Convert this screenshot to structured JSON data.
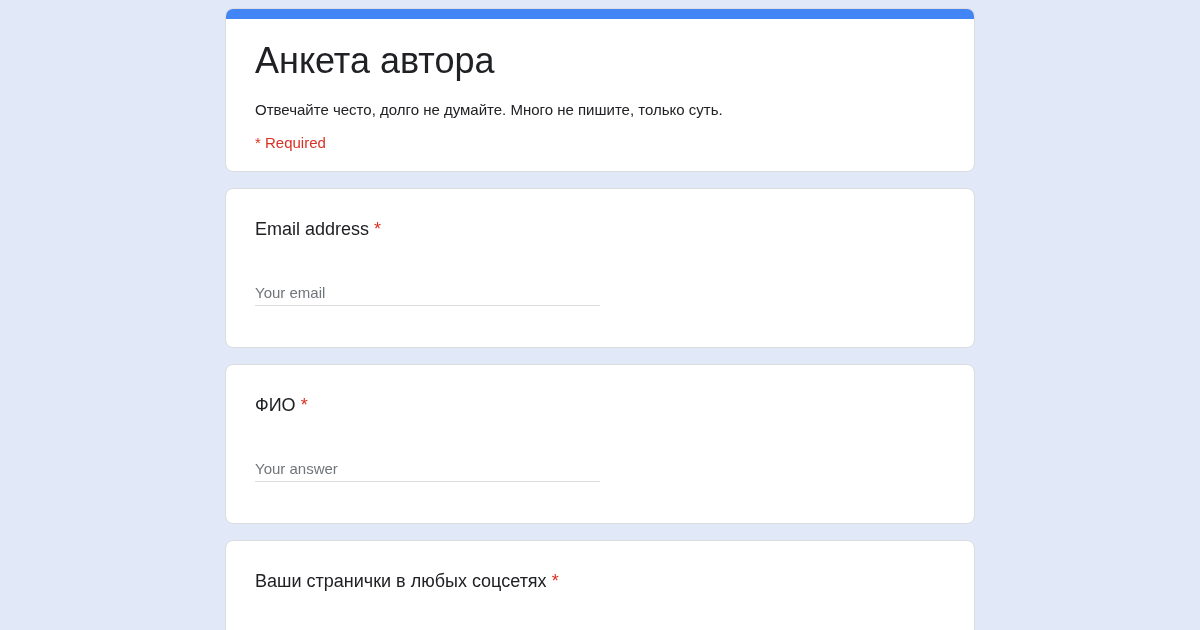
{
  "form": {
    "title": "Анкета автора",
    "description": "Отвечайте често, долго не думайте. Много не пишите, только суть.",
    "required_note": "* Required"
  },
  "questions": [
    {
      "label": "Email address",
      "required_mark": "*",
      "placeholder": "Your email"
    },
    {
      "label": "ФИО",
      "required_mark": "*",
      "placeholder": "Your answer"
    },
    {
      "label": "Ваши странички в любых соцсетях",
      "required_mark": "*"
    }
  ]
}
